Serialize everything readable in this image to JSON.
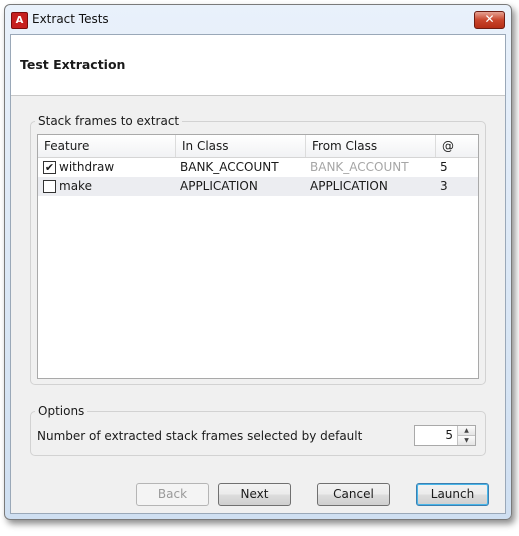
{
  "window": {
    "title": "Extract Tests"
  },
  "header": {
    "title": "Test Extraction"
  },
  "frames": {
    "legend": "Stack frames to extract",
    "columns": [
      "Feature",
      "In Class",
      "From Class",
      "@"
    ],
    "rows": [
      {
        "checked": true,
        "check_mark": "✔",
        "feature": "withdraw",
        "in_class": "BANK_ACCOUNT",
        "from_class": "BANK_ACCOUNT",
        "from_class_dimmed": true,
        "line": "5"
      },
      {
        "checked": false,
        "check_mark": "",
        "feature": "make",
        "in_class": "APPLICATION",
        "from_class": "APPLICATION",
        "from_class_dimmed": false,
        "line": "3"
      }
    ]
  },
  "options": {
    "legend": "Options",
    "default_count_label": "Number of extracted stack frames selected by default",
    "default_count_value": "5"
  },
  "buttons": {
    "back": "Back",
    "next": "Next",
    "cancel": "Cancel",
    "launch": "Launch"
  },
  "colors": {
    "titlebar": "#dce7f5",
    "close": "#c9452c",
    "row_alt": "#ecedf1",
    "default_button_border": "#3c7fb1"
  }
}
